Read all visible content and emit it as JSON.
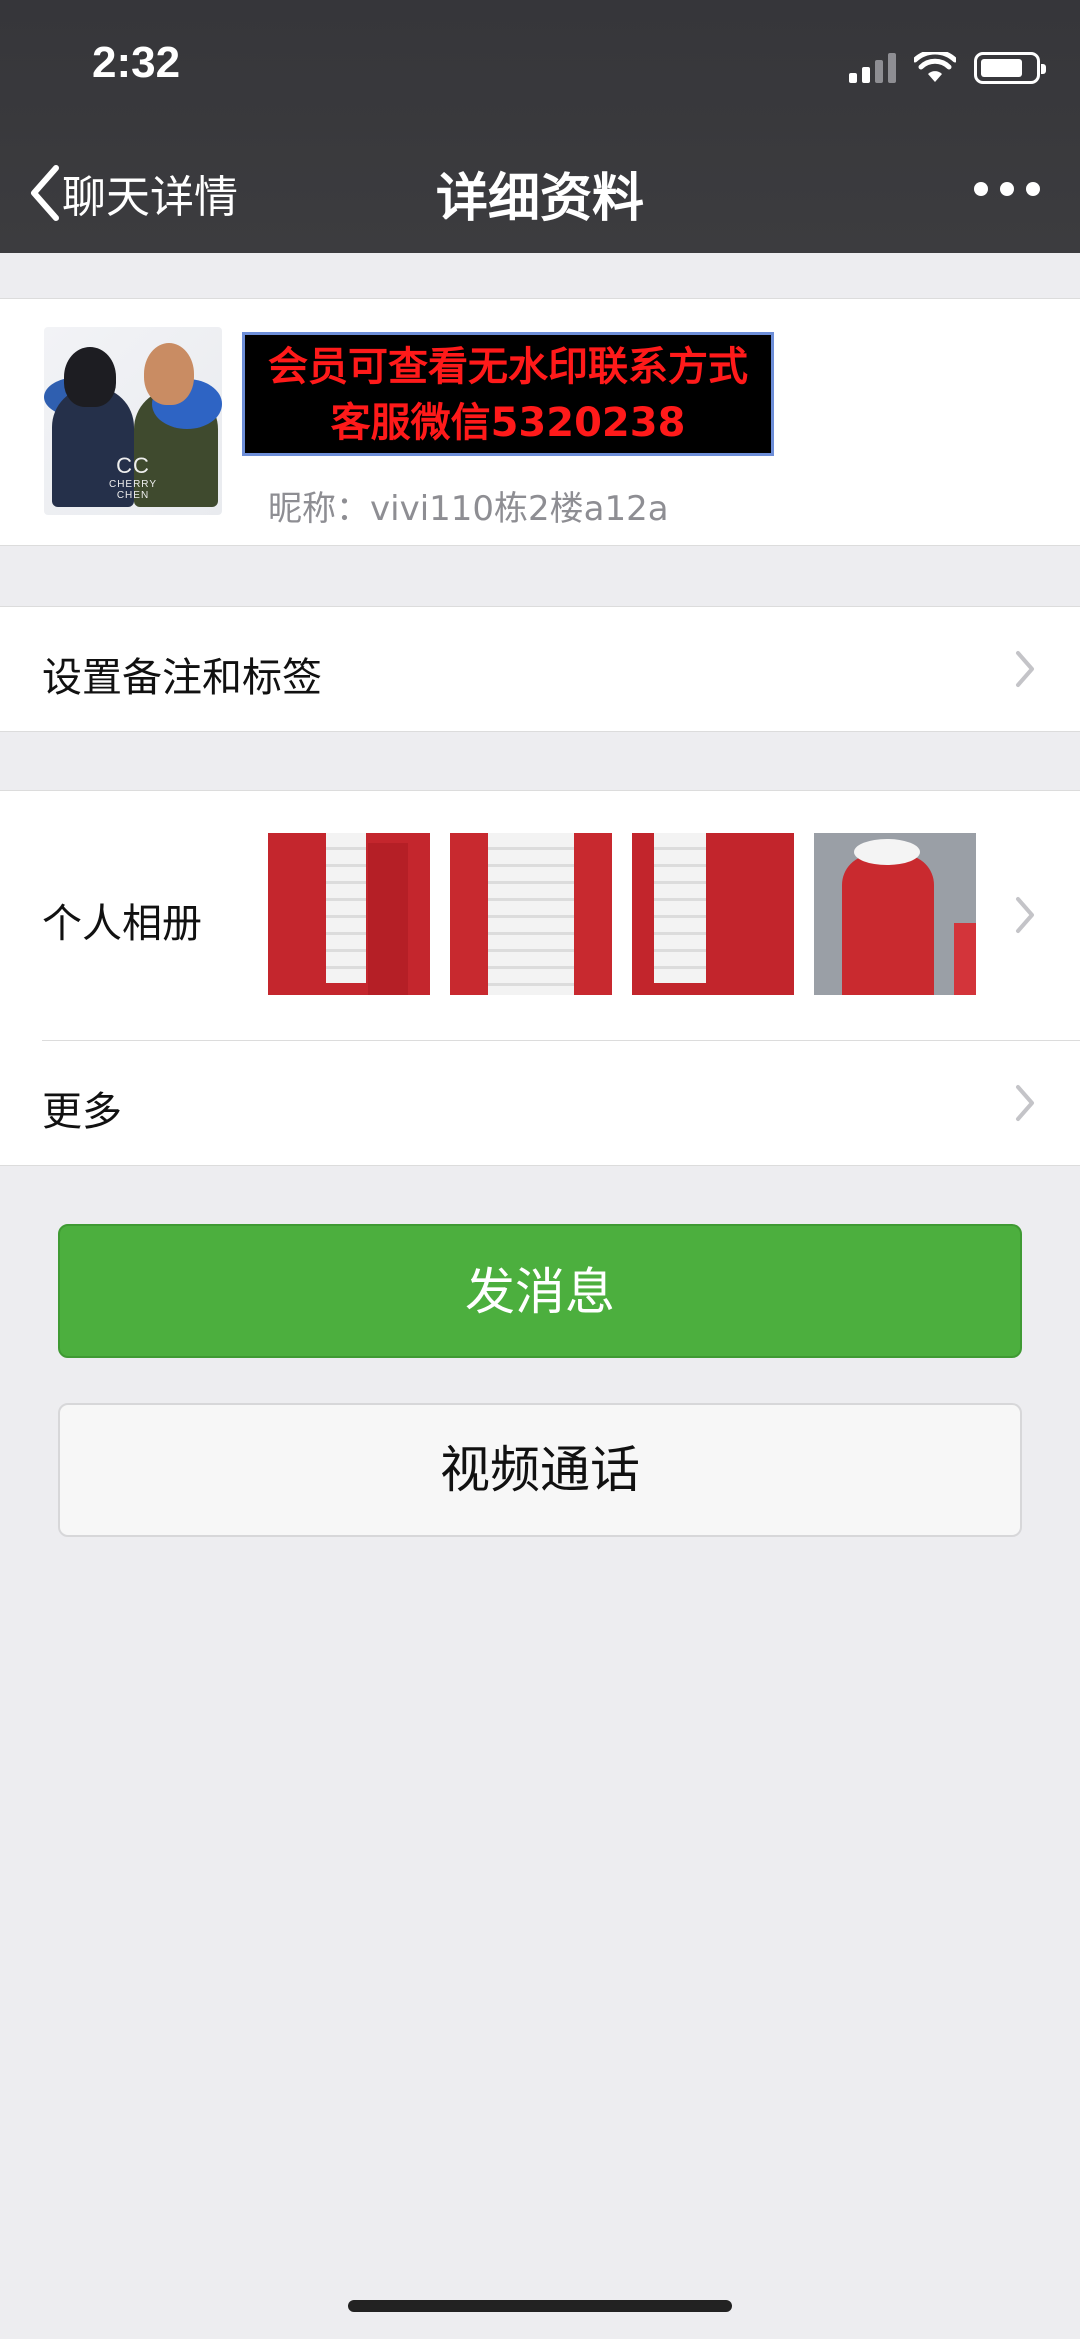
{
  "status_bar": {
    "time": "2:32",
    "signal_bars": 4,
    "signal_bars_active": 2,
    "battery_level": 0.78,
    "icons": [
      "signal-icon",
      "wifi-icon",
      "battery-icon"
    ]
  },
  "nav": {
    "back_label": "聊天详情",
    "title": "详细资料",
    "more_icon": "more-dots-icon"
  },
  "profile": {
    "watermark_line1": "会员可查看无水印联系方式",
    "watermark_line2": "客服微信5320238",
    "nickname": "昵称：vivi110栋2楼a12a",
    "avatar_logo": "CC",
    "avatar_logo_sub": "CHERRY CHEN"
  },
  "rows": {
    "remarks_label": "设置备注和标签",
    "album_label": "个人相册",
    "more_label": "更多"
  },
  "buttons": {
    "send_message": "发消息",
    "video_call": "视频通话"
  },
  "colors": {
    "header_bg": "#3a3a3c",
    "page_bg": "#ededf0",
    "primary_green": "#4caf3e",
    "watermark_text": "#ff1a1a"
  }
}
